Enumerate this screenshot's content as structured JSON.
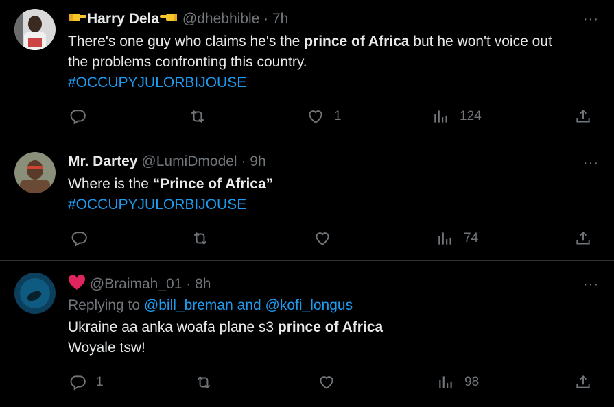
{
  "tweets": [
    {
      "name": "Harry Dela",
      "handle": "@dhebhible",
      "time": "7h",
      "body_lines": [
        {
          "pre": "There's one guy who claims he's the ",
          "bold": "prince of Africa",
          "post": " but he won't voice out"
        },
        {
          "pre": "the problems confronting this country.",
          "bold": "",
          "post": ""
        }
      ],
      "hashtag": "#OCCUPYJULORBIJOUSE",
      "reply_count": "",
      "like_count": "1",
      "view_count": "124"
    },
    {
      "name": "Mr. Dartey",
      "handle": "@LumiDmodel",
      "time": "9h",
      "body_lines": [
        {
          "pre": "Where is the ",
          "bold": "“Prince of Africa”",
          "post": ""
        }
      ],
      "hashtag": "#OCCUPYJULORBIJOUSE",
      "reply_count": "",
      "like_count": "",
      "view_count": "74"
    },
    {
      "name": "",
      "handle": "@Braimah_01",
      "time": "8h",
      "replying_to_label": "Replying to",
      "replying_to_user1": "@bill_breman",
      "replying_to_and": "and",
      "replying_to_user2": "@kofi_longus",
      "body_lines": [
        {
          "pre": "Ukraine aa anka woafa plane s3 ",
          "bold": "prince of Africa",
          "post": ""
        },
        {
          "pre": "Woyale tsw!",
          "bold": "",
          "post": ""
        }
      ],
      "reply_count": "1",
      "like_count": "",
      "view_count": "98"
    }
  ],
  "separator": "·",
  "more_label": "···",
  "icons": [
    "reply-icon",
    "retweet-icon",
    "like-icon",
    "views-icon",
    "share-icon"
  ],
  "colors": {
    "background": "#000000",
    "text": "#e7e9ea",
    "muted": "#71767b",
    "link": "#1d9bf0",
    "heart": "#f91880"
  }
}
